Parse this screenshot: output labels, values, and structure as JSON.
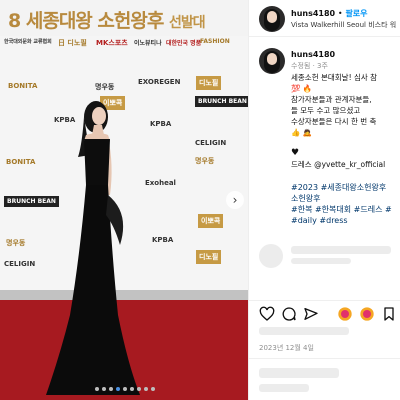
{
  "photo": {
    "banner_title_num": "8",
    "banner_title": "세종대왕 소헌왕후",
    "banner_suffix": "선발대",
    "logos": [
      "한국대외문화 교류협회",
      "日 디노필",
      "MK스포츠",
      "이노뷰티나",
      "대한민국 명품",
      "FASHION",
      "BONITA",
      "명우동",
      "EXOREGEN",
      "디노필",
      "KPBA",
      "이뽀콕",
      "BRUNCH BEAN",
      "KPBA",
      "CELIGIN",
      "명우동",
      "Exoheal",
      "BRUNCH BEAN",
      "CELIGIN",
      "KPBA",
      "이뽀콕",
      "명우동",
      "BONITA",
      "디노필"
    ],
    "dots_count": 9,
    "dots_active": 3
  },
  "header": {
    "username": "huns4180",
    "follow_sep": "•",
    "follow": "팔로우",
    "location": "Vista Walkerhill Seoul 비스타 워"
  },
  "caption": {
    "username": "huns4180",
    "edited": "수정됨",
    "time": "3주",
    "lines": [
      "세종소헌 본대회날! 심사 참",
      "💯 🔥",
      "참가자분들과 관계자분들,",
      "들 모두 수고 많으셨고",
      "수상자분들은 다시 한 번 축",
      "👍 🙇"
    ],
    "heart": "♥",
    "dress_credit": "드레스 @yvette_kr_official",
    "hashtags": [
      "#2023 #세종대왕소헌왕후",
      "소헌왕후",
      "#한복 #한복대회 #드레스 #",
      "#daily #dress"
    ]
  },
  "footer": {
    "date": "2023년 12월 4일"
  }
}
